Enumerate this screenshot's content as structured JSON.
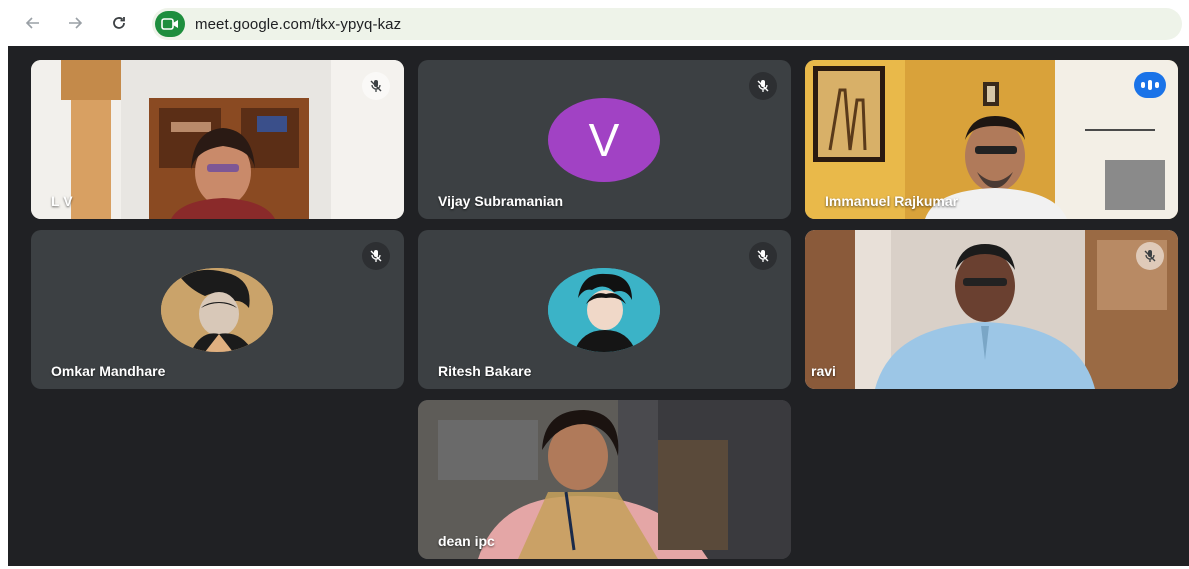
{
  "browser": {
    "url": "meet.google.com/tkx-ypyq-kaz",
    "back_icon": "arrow-left-icon",
    "forward_icon": "arrow-right-icon",
    "reload_icon": "reload-icon",
    "site_icon": "meet-camera-icon"
  },
  "meeting": {
    "participants": [
      {
        "name": "L V",
        "muted": true,
        "video": true
      },
      {
        "name": "Vijay Subramanian",
        "muted": true,
        "video": false,
        "avatar_letter": "V",
        "avatar_color": "#a142c4"
      },
      {
        "name": "Immanuel Rajkumar",
        "muted": false,
        "speaking": true,
        "video": true
      },
      {
        "name": "Omkar Mandhare",
        "muted": true,
        "video": false,
        "avatar_image": "anime-character"
      },
      {
        "name": "Ritesh Bakare",
        "muted": true,
        "video": false,
        "avatar_image": "anime-character"
      },
      {
        "name": "ravi",
        "muted": true,
        "video": true
      },
      {
        "name": "dean ipc",
        "muted": false,
        "video": true
      }
    ]
  },
  "colors": {
    "stage_bg": "#202124",
    "tile_bg": "#3c4043",
    "speaking_blue": "#1a73e8",
    "active_border": "#8ab4f8",
    "omnibox_bg": "#eef3e9",
    "meet_green": "#1e8e3e"
  }
}
